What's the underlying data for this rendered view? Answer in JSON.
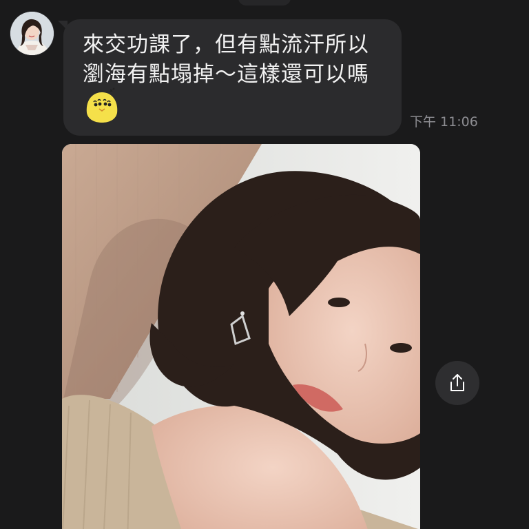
{
  "message": {
    "text": "來交功課了，但有點流汗所以\n瀏海有點塌掉～這樣還可以嗎",
    "timestamp": "下午 11:06",
    "sticker": "yellow-chick-sticker"
  },
  "contact": {
    "avatar": "contact-avatar"
  },
  "photo": {
    "description_icon": "photo-selfie"
  },
  "actions": {
    "share_icon": "share-icon"
  },
  "colors": {
    "background": "#1a1a1b",
    "bubble": "#2b2b2d",
    "text": "#f2f2f2",
    "timestamp": "#8d8d92",
    "sticker_yellow": "#f5e04a"
  }
}
